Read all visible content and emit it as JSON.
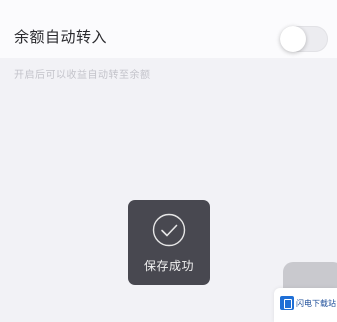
{
  "setting": {
    "title": "余额自动转入",
    "toggle_on": false,
    "hint": "开启后可以收益自动转至余额"
  },
  "toast": {
    "message": "保存成功",
    "icon": "check-circle-icon"
  },
  "watermark": {
    "text": "闪电下载站"
  }
}
